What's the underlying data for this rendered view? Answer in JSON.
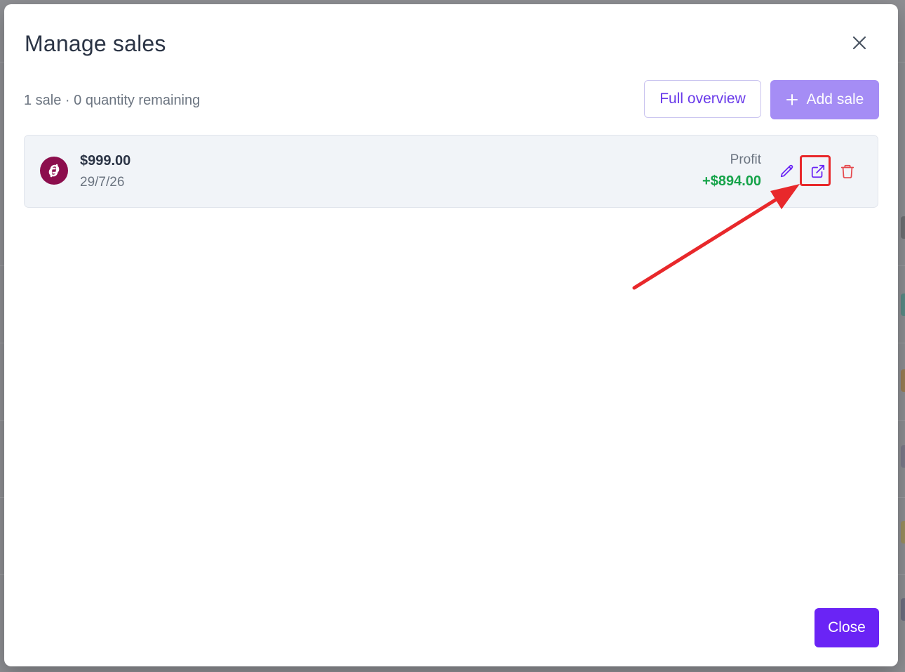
{
  "modal": {
    "title": "Manage sales",
    "summary": "1 sale · 0 quantity remaining",
    "full_overview_label": "Full overview",
    "add_sale_label": "Add sale",
    "close_label": "Close"
  },
  "sales": [
    {
      "platform_icon": "poshmark-logo-icon",
      "price": "$999.00",
      "date": "29/7/26",
      "profit_label": "Profit",
      "profit_value": "+$894.00"
    }
  ],
  "icons": {
    "close": "close-icon",
    "edit": "pencil-icon",
    "open": "external-link-icon",
    "delete": "trash-icon",
    "add": "plus-icon"
  },
  "colors": {
    "accent": "#6a24f5",
    "accent_light": "#a58df5",
    "profit": "#16a34a",
    "delete": "#e5484d",
    "annotation": "#e8282b",
    "logo_bg": "#8c0e4d"
  }
}
